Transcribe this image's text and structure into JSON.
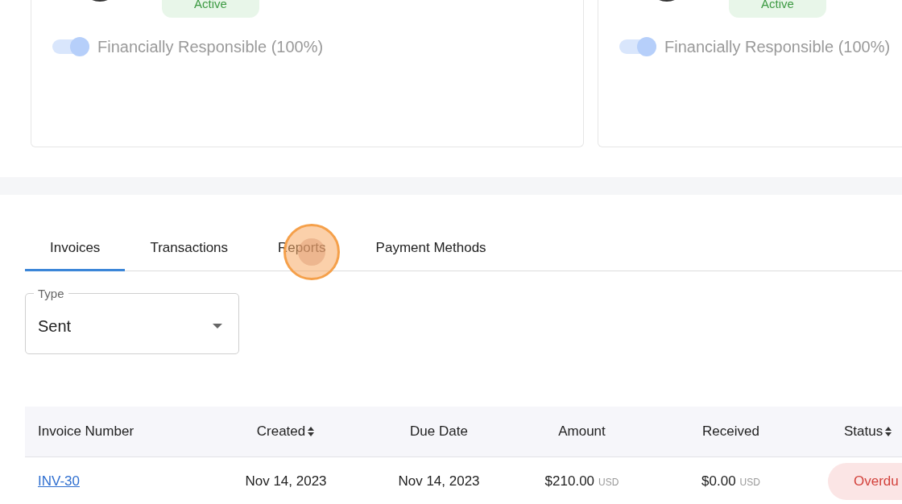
{
  "members": [
    {
      "status": "Active",
      "responsible": {
        "label": "Financially Responsible (100%)",
        "on": true
      }
    },
    {
      "status": "Active",
      "responsible": {
        "label": "Financially Responsible (100%)",
        "on": true
      }
    }
  ],
  "tabs": [
    {
      "label": "Invoices",
      "selected": true
    },
    {
      "label": "Transactions",
      "selected": false
    },
    {
      "label": "Reports",
      "selected": false
    },
    {
      "label": "Payment Methods",
      "selected": false
    }
  ],
  "type_select": {
    "label": "Type",
    "value": "Sent"
  },
  "table": {
    "columns": [
      {
        "label": "Invoice Number",
        "sortable": false
      },
      {
        "label": "Created",
        "sortable": true
      },
      {
        "label": "Due Date",
        "sortable": false
      },
      {
        "label": "Amount",
        "sortable": false
      },
      {
        "label": "Received",
        "sortable": false
      },
      {
        "label": "Status",
        "sortable": true
      }
    ],
    "rows": [
      {
        "invoice_number": "INV-30",
        "created": "Nov 14, 2023",
        "due_date": "Nov 14, 2023",
        "amount": "$210.00",
        "amount_currency": "USD",
        "received": "$0.00",
        "received_currency": "USD",
        "status": "Overdu"
      }
    ]
  }
}
